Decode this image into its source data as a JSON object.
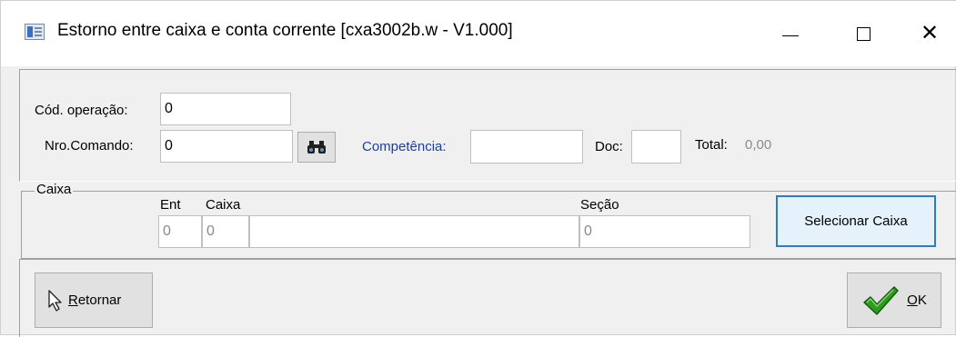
{
  "window": {
    "title": "Estorno entre caixa e conta corrente [cxa3002b.w - V1.000]",
    "controls": {
      "minimize": "minimize",
      "maximize": "maximize",
      "close": "close"
    }
  },
  "form": {
    "cod_operacao": {
      "label": "Cód. operação:",
      "value": "0"
    },
    "nro_comando": {
      "label": "Nro.Comando:",
      "value": "0"
    },
    "competencia": {
      "label": "Competência:",
      "value": ""
    },
    "doc": {
      "label": "Doc:",
      "value": ""
    },
    "total": {
      "label": "Total:",
      "value": "0,00"
    }
  },
  "caixa_group": {
    "title": "Caixa",
    "columns": {
      "ent": "Ent",
      "caixa": "Caixa",
      "secao": "Seção"
    },
    "ent_value": "0",
    "caixa_value": "0",
    "caixa_desc": "",
    "secao_value": "0",
    "select_button": "Selecionar Caixa"
  },
  "footer": {
    "retornar_rest": "etornar",
    "retornar_accel": "R",
    "ok_accel": "O",
    "ok_rest": "K"
  },
  "icons": {
    "search": "binoculars-icon",
    "retornar": "pointer-icon",
    "ok": "checkmark-icon"
  }
}
